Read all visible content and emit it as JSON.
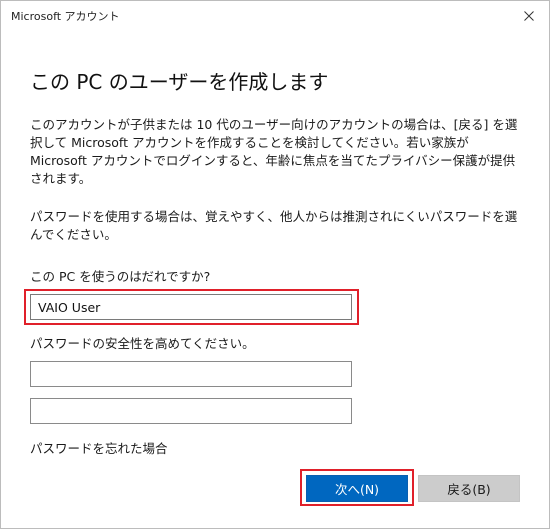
{
  "window": {
    "title": "Microsoft アカウント"
  },
  "content": {
    "heading": "この PC のユーザーを作成します",
    "paragraph1": "このアカウントが子供または 10 代のユーザー向けのアカウントの場合は、[戻る] を選択して Microsoft アカウントを作成することを検討してください。若い家族が Microsoft アカウントでログインすると、年齢に焦点を当てたプライバシー保護が提供されます。",
    "paragraph2": "パスワードを使用する場合は、覚えやすく、他人からは推測されにくいパスワードを選んでください。",
    "who_label": "この PC を使うのはだれですか?",
    "username_value": "VAIO User",
    "password_label": "パスワードの安全性を高めてください。",
    "password_value": "",
    "password_confirm_value": "",
    "forgot_link": "パスワードを忘れた場合"
  },
  "buttons": {
    "next": "次へ(N)",
    "back": "戻る(B)"
  },
  "colors": {
    "accent": "#0067c0",
    "highlight": "#e0202a",
    "secondary_button": "#cccccc"
  },
  "icons": {
    "close": "close-icon"
  }
}
